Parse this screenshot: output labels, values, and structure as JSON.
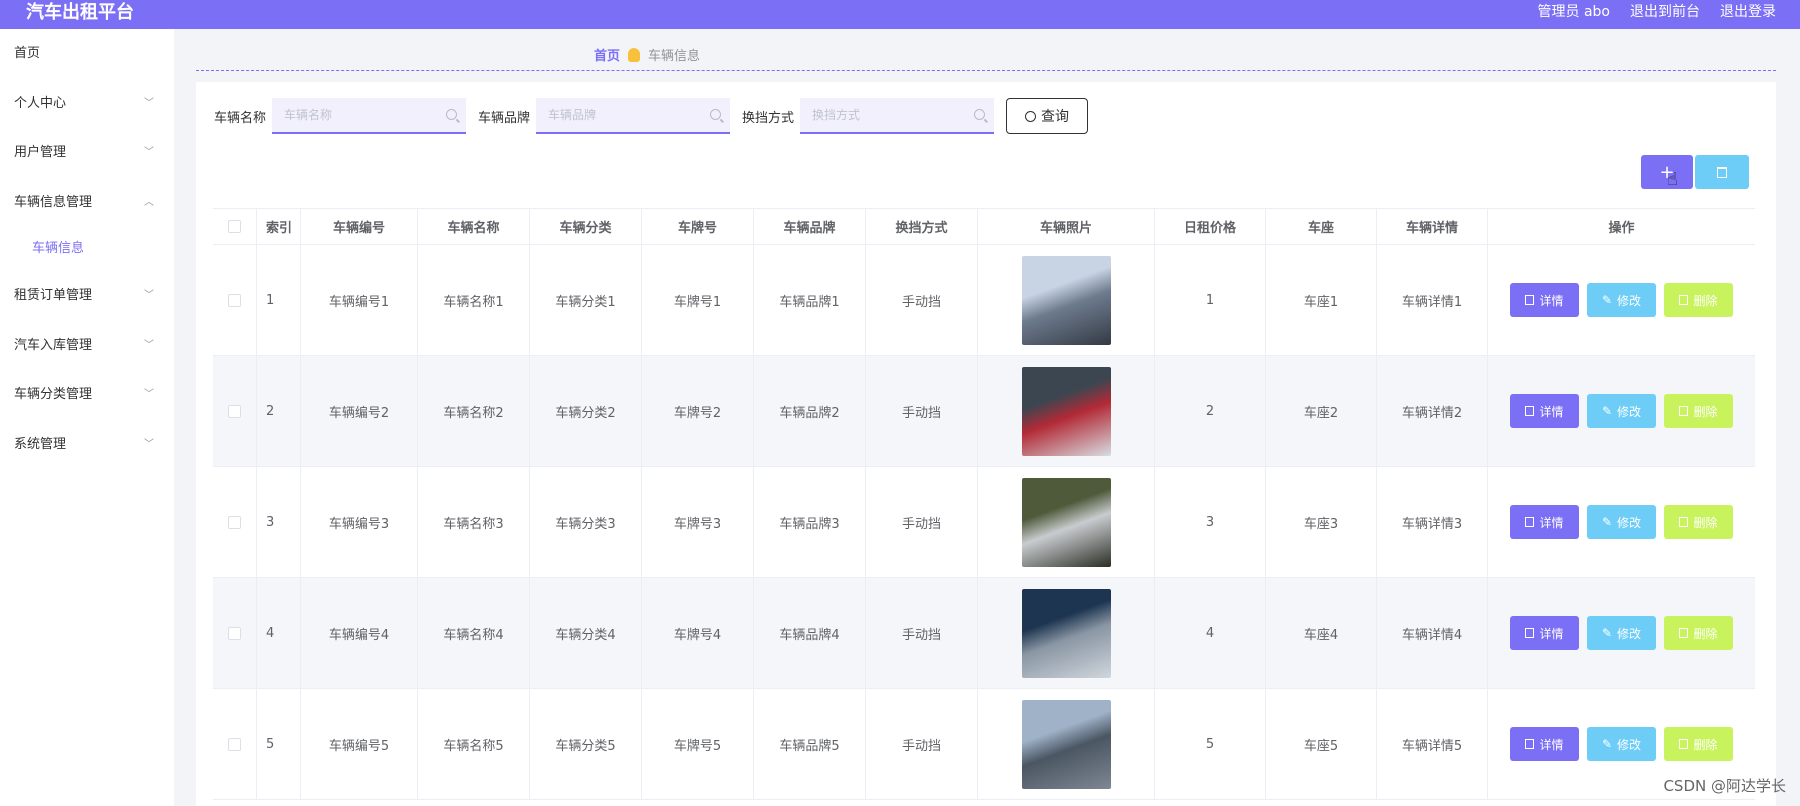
{
  "app": {
    "title": "汽车出租平台"
  },
  "topbar": {
    "admin_label": "管理员 abo",
    "front_link": "退出到前台",
    "logout_link": "退出登录"
  },
  "sidebar": {
    "items": [
      {
        "label": "首页"
      },
      {
        "label": "个人中心"
      },
      {
        "label": "用户管理"
      },
      {
        "label": "车辆信息管理"
      },
      {
        "label": "车辆信息"
      },
      {
        "label": "租赁订单管理"
      },
      {
        "label": "汽车入库管理"
      },
      {
        "label": "车辆分类管理"
      },
      {
        "label": "系统管理"
      }
    ]
  },
  "breadcrumb": {
    "home": "首页",
    "current": "车辆信息"
  },
  "search": {
    "name_label": "车辆名称",
    "name_placeholder": "车辆名称",
    "brand_label": "车辆品牌",
    "brand_placeholder": "车辆品牌",
    "gear_label": "换挡方式",
    "gear_placeholder": "换挡方式",
    "query_button": "查询"
  },
  "table": {
    "headers": [
      "索引",
      "车辆编号",
      "车辆名称",
      "车辆分类",
      "车牌号",
      "车辆品牌",
      "换挡方式",
      "车辆照片",
      "日租价格",
      "车座",
      "车辆详情",
      "操作"
    ],
    "rows": [
      {
        "idx": "1",
        "code": "车辆编号1",
        "name": "车辆名称1",
        "category": "车辆分类1",
        "plate": "车牌号1",
        "brand": "车辆品牌1",
        "gear": "手动挡",
        "price": "1",
        "seat": "车座1",
        "detail": "车辆详情1",
        "photo_colors": [
          "#c8d4e4",
          "#6d7b8e",
          "#343a44"
        ]
      },
      {
        "idx": "2",
        "code": "车辆编号2",
        "name": "车辆名称2",
        "category": "车辆分类2",
        "plate": "车牌号2",
        "brand": "车辆品牌2",
        "gear": "手动挡",
        "price": "2",
        "seat": "车座2",
        "detail": "车辆详情2",
        "photo_colors": [
          "#3c4650",
          "#b22a36",
          "#d8dde2"
        ]
      },
      {
        "idx": "3",
        "code": "车辆编号3",
        "name": "车辆名称3",
        "category": "车辆分类3",
        "plate": "车牌号3",
        "brand": "车辆品牌3",
        "gear": "手动挡",
        "price": "3",
        "seat": "车座3",
        "detail": "车辆详情3",
        "photo_colors": [
          "#4e5a3a",
          "#c9cccf",
          "#2a2e25"
        ]
      },
      {
        "idx": "4",
        "code": "车辆编号4",
        "name": "车辆名称4",
        "category": "车辆分类4",
        "plate": "车牌号4",
        "brand": "车辆品牌4",
        "gear": "手动挡",
        "price": "4",
        "seat": "车座4",
        "detail": "车辆详情4",
        "photo_colors": [
          "#1d3550",
          "#8a96a4",
          "#d0d6dc"
        ]
      },
      {
        "idx": "5",
        "code": "车辆编号5",
        "name": "车辆名称5",
        "category": "车辆分类5",
        "plate": "车牌号5",
        "brand": "车辆品牌5",
        "gear": "手动挡",
        "price": "5",
        "seat": "车座5",
        "detail": "车辆详情5",
        "photo_colors": [
          "#9fb2c8",
          "#4b5663",
          "#7e8792"
        ]
      }
    ],
    "actions": {
      "view": "详情",
      "edit": "修改",
      "delete": "删除"
    }
  },
  "colors": {
    "accent": "#7b6ff5",
    "edit": "#6ecdf7",
    "delete": "#c9f35c"
  },
  "watermark": "CSDN @阿达学长"
}
